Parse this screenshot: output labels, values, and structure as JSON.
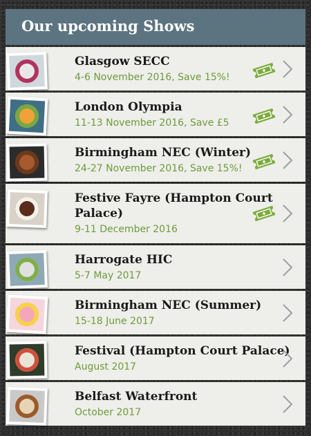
{
  "header": {
    "title": "Our upcoming Shows"
  },
  "colors": {
    "header": "#5c7480",
    "row": "#eeeeea",
    "subtitle": "#6e9b3c",
    "ticket": "#7cab3d",
    "chevron": "#9aa0a4"
  },
  "shows": [
    {
      "name": "Glasgow SECC",
      "detail": "4-6 November 2016, Save 15%!",
      "has_ticket_icon": true,
      "thumb_icon": "food-thumbnail-icon"
    },
    {
      "name": "London Olympia",
      "detail": "11-13 November 2016, Save £5",
      "has_ticket_icon": true,
      "thumb_icon": "food-thumbnail-icon"
    },
    {
      "name": "Birmingham NEC (Winter)",
      "detail": "24-27 November 2016, Save 15%!",
      "has_ticket_icon": true,
      "thumb_icon": "food-thumbnail-icon"
    },
    {
      "name": "Festive Fayre (Hampton Court Palace)",
      "detail": "9-11 December 2016",
      "has_ticket_icon": true,
      "thumb_icon": "food-thumbnail-icon"
    },
    {
      "name": "Harrogate HIC",
      "detail": "5-7 May 2017",
      "has_ticket_icon": false,
      "thumb_icon": "food-thumbnail-icon"
    },
    {
      "name": "Birmingham NEC (Summer)",
      "detail": "15-18 June 2017",
      "has_ticket_icon": false,
      "thumb_icon": "food-thumbnail-icon"
    },
    {
      "name": "Festival (Hampton Court Palace)",
      "detail": "August 2017",
      "has_ticket_icon": false,
      "thumb_icon": "food-thumbnail-icon"
    },
    {
      "name": "Belfast Waterfront",
      "detail": "October 2017",
      "has_ticket_icon": false,
      "thumb_icon": "food-thumbnail-icon"
    }
  ]
}
